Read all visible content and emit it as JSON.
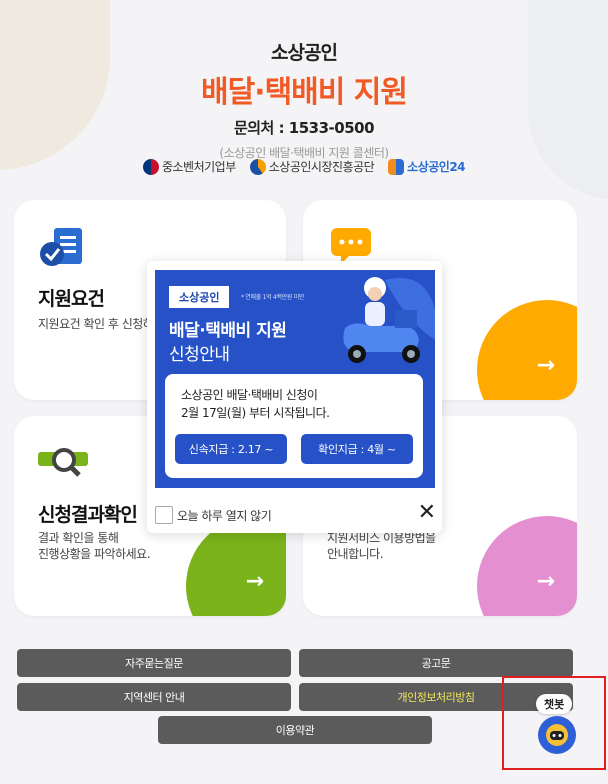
{
  "header": {
    "subtitle": "소상공인",
    "title": "배달·택배비 지원",
    "phone": "문의처 : 1533-0500",
    "center": "(소상공인 배달·택배비 지원 콜센터)"
  },
  "logos": [
    {
      "label": "중소벤처기업부"
    },
    {
      "label": "소상공인시장진흥공단"
    },
    {
      "label": "소상공인24"
    }
  ],
  "cards": {
    "requirements": {
      "title": "지원요건",
      "desc": "지원요건 확인 후 신청하"
    },
    "apply": {
      "title": "",
      "desc": ""
    },
    "result": {
      "title": "신청결과확인",
      "desc1": "결과 확인을 통해",
      "desc2": "진행상황을 파악하세요."
    },
    "guide": {
      "title": "",
      "desc1": "지원서비스 이용방법을",
      "desc2": "안내합니다."
    }
  },
  "arrow_glyph": "→",
  "buttons": {
    "faq": "자주묻는질문",
    "notice": "공고문",
    "regional": "지역센터 안내",
    "privacy": "개인정보처리방침",
    "terms": "이용약관"
  },
  "popup": {
    "tag": "소상공인",
    "note": "* 연매출 1억 4백만원 미만",
    "title1": "배달·택배비 지원",
    "title2": "신청안내",
    "body1": "소상공인 배달·택배비 신청이",
    "body2": "2월 17일(월) 부터 시작됩니다.",
    "fast_pay": "신속지급 : 2.17 ~",
    "confirm_pay": "확인지급 : 4월 ~",
    "dont_show": "오늘 하루 열지 않기",
    "close": "✕"
  },
  "chatbot": {
    "label": "챗봇"
  },
  "colors": {
    "accent": "#f15a24",
    "banner": "#2752c7",
    "orange": "#ffaa00",
    "green": "#7bb31a",
    "pink": "#e48fcf",
    "highlight": "#f3e75b"
  }
}
